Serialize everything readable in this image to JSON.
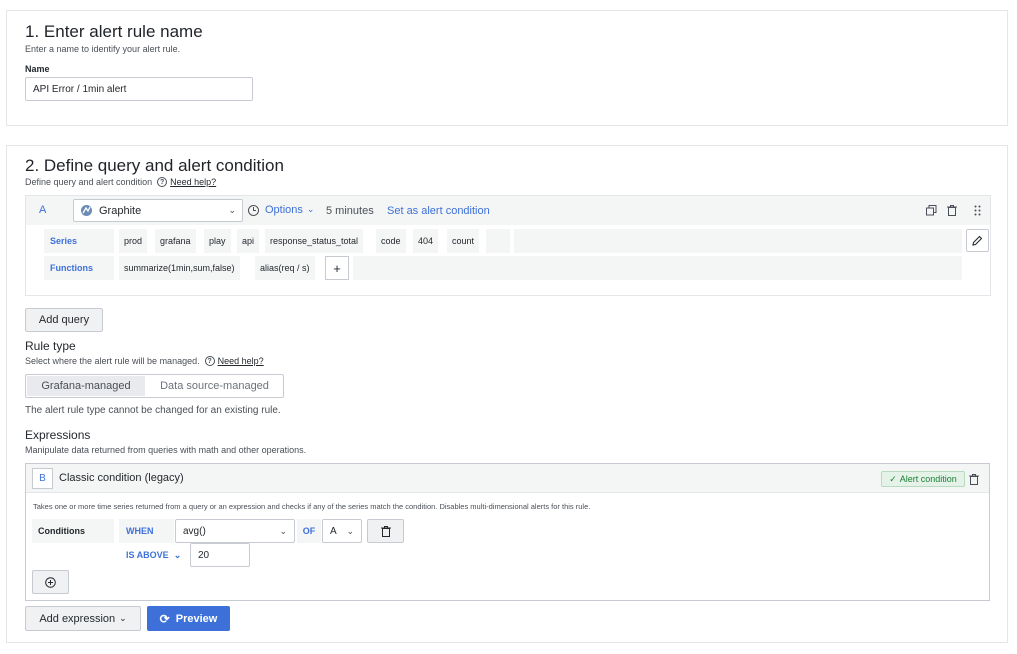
{
  "section1": {
    "title": "1. Enter alert rule name",
    "description": "Enter a name to identify your alert rule.",
    "name_label": "Name",
    "name_value": "API Error  / 1min alert"
  },
  "section2": {
    "title": "2. Define query and alert condition",
    "description": "Define query and alert condition",
    "help_link": "Need help?",
    "query": {
      "ref_id": "A",
      "datasource": "Graphite",
      "options_label": "Options",
      "time_range": "5 minutes",
      "set_alert_condition": "Set as alert condition",
      "series_label": "Series",
      "series_segments": [
        "prod",
        "grafana",
        "play",
        "api",
        "response_status_total",
        "code",
        "404",
        "count"
      ],
      "functions_label": "Functions",
      "functions": [
        "summarize(1min,sum,false)",
        "alias(req / s)"
      ],
      "add_function": "+"
    },
    "add_query_label": "Add query",
    "rule_type": {
      "title": "Rule type",
      "description": "Select where the alert rule will be managed.",
      "help_link": "Need help?",
      "tabs": [
        "Grafana-managed",
        "Data source-managed"
      ],
      "selected": "Grafana-managed",
      "note": "The alert rule type cannot be changed for an existing rule."
    },
    "expressions": {
      "title": "Expressions",
      "description": "Manipulate data returned from queries with math and other operations.",
      "card": {
        "ref_id": "B",
        "title": "Classic condition (legacy)",
        "badge": "Alert condition",
        "info": "Takes one or more time series returned from a query or an expression and checks if any of the series match the condition. Disables multi-dimensional alerts for this rule.",
        "conditions_label": "Conditions",
        "when_label": "WHEN",
        "reducer": "avg()",
        "of_label": "OF",
        "query_ref": "A",
        "evaluator": "IS ABOVE",
        "threshold": "20"
      }
    },
    "add_expression_label": "Add expression",
    "preview_label": "Preview"
  },
  "colors": {
    "accent": "#3d71d9",
    "primary_button": "#3d71d9",
    "success_badge": "#1a7f37"
  }
}
